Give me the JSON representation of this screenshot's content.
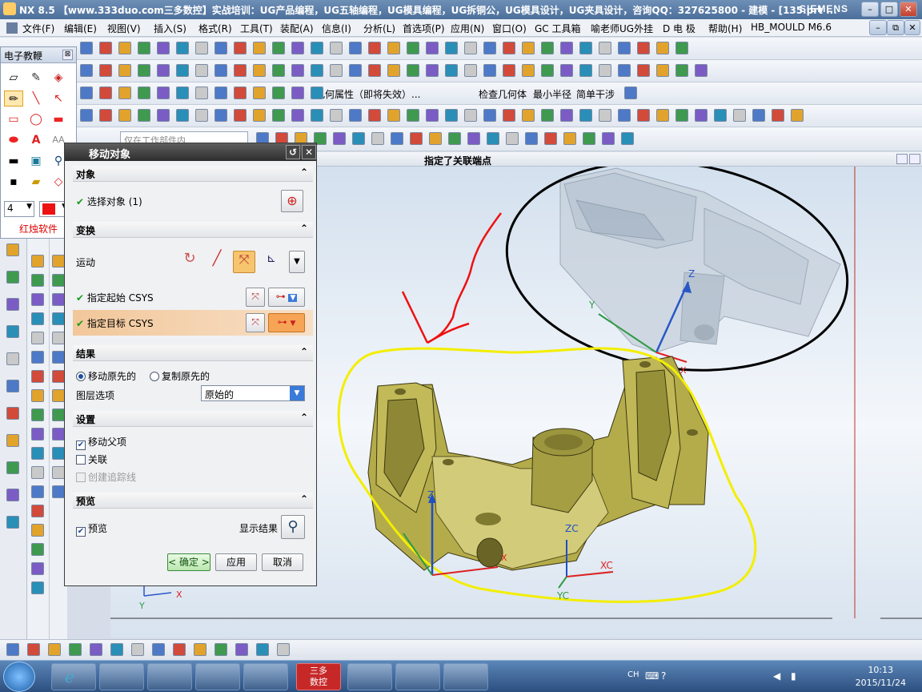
{
  "window": {
    "title": "NX 8.5 【www.333duo.com三多数控】实战培训：UG产品编程，UG五轴编程，UG模具编程，UG拆铜公，UG模具设计，UG夹具设计，咨询QQ：327625800 - 建模 - [135.prt ...",
    "brand": "SIEMENS",
    "controls": [
      "–",
      "□",
      "✕"
    ]
  },
  "menubar": {
    "items": [
      "文件(F)",
      "编辑(E)",
      "视图(V)",
      "插入(S)",
      "格式(R)",
      "工具(T)",
      "装配(A)",
      "信息(I)",
      "分析(L)",
      "首选项(P)",
      "应用(N)",
      "窗口(O)",
      "GC 工具箱",
      "喻老师UG外挂",
      "D 电 极",
      "帮助(H)",
      "HB_MOULD M6.6"
    ],
    "right_controls": [
      "–",
      "⧉",
      "✕"
    ]
  },
  "toolbar": {
    "geometry_property": "几何属性（即将失效）...",
    "check_geometry": "检查几何体",
    "min_radius": "最小半径",
    "simple_interference": "简单干涉",
    "filter_placeholder": "仅在工作部件内"
  },
  "viewport": {
    "status": "指定了关联端点",
    "axis_labels": {
      "z1": "Z",
      "y1": "Y",
      "x1": "X",
      "z2": "Z",
      "x2": "X",
      "zc": "ZC",
      "xc": "XC",
      "yc": "YC",
      "wcs_x": "X",
      "wcs_y": "Y"
    }
  },
  "palette": {
    "title": "电子教鞭",
    "close": "⊠",
    "size_value": "4",
    "footer": "红烛软件",
    "text_glyph": "A",
    "text_glyph2": "AA"
  },
  "dialog": {
    "title": "移动对象",
    "object_section": "对象",
    "select_object": "选择对象 (1)",
    "transform_section": "变换",
    "motion_label": "运动",
    "start_csys": "指定起始 CSYS",
    "target_csys": "指定目标 CSYS",
    "result_section": "结果",
    "move_original": "移动原先的",
    "copy_original": "复制原先的",
    "layer_option_label": "图层选项",
    "layer_option_value": "原始的",
    "settings_section": "设置",
    "move_parent": "移动父项",
    "associative": "关联",
    "create_trace": "创建追踪线",
    "preview_section": "预览",
    "preview": "预览",
    "show_result": "显示结果",
    "ok": "< 确定 >",
    "apply": "应用",
    "cancel": "取消",
    "checks": {
      "move_parent": true,
      "associative": false,
      "create_trace": false,
      "preview": true
    }
  },
  "taskbar": {
    "lang": "CH",
    "time": "10:13",
    "date": "2015/11/24",
    "sanduo_label_top": "三多",
    "sanduo_label_bottom": "数控"
  },
  "colors": {
    "annotation_red": "#ee1111",
    "annotation_black": "#000000",
    "annotation_yellow": "#f3ee00",
    "part_yellow": "#b7b04c",
    "ghost_gray": "#c8d2dc",
    "target_highlight": "#f2c79a"
  }
}
